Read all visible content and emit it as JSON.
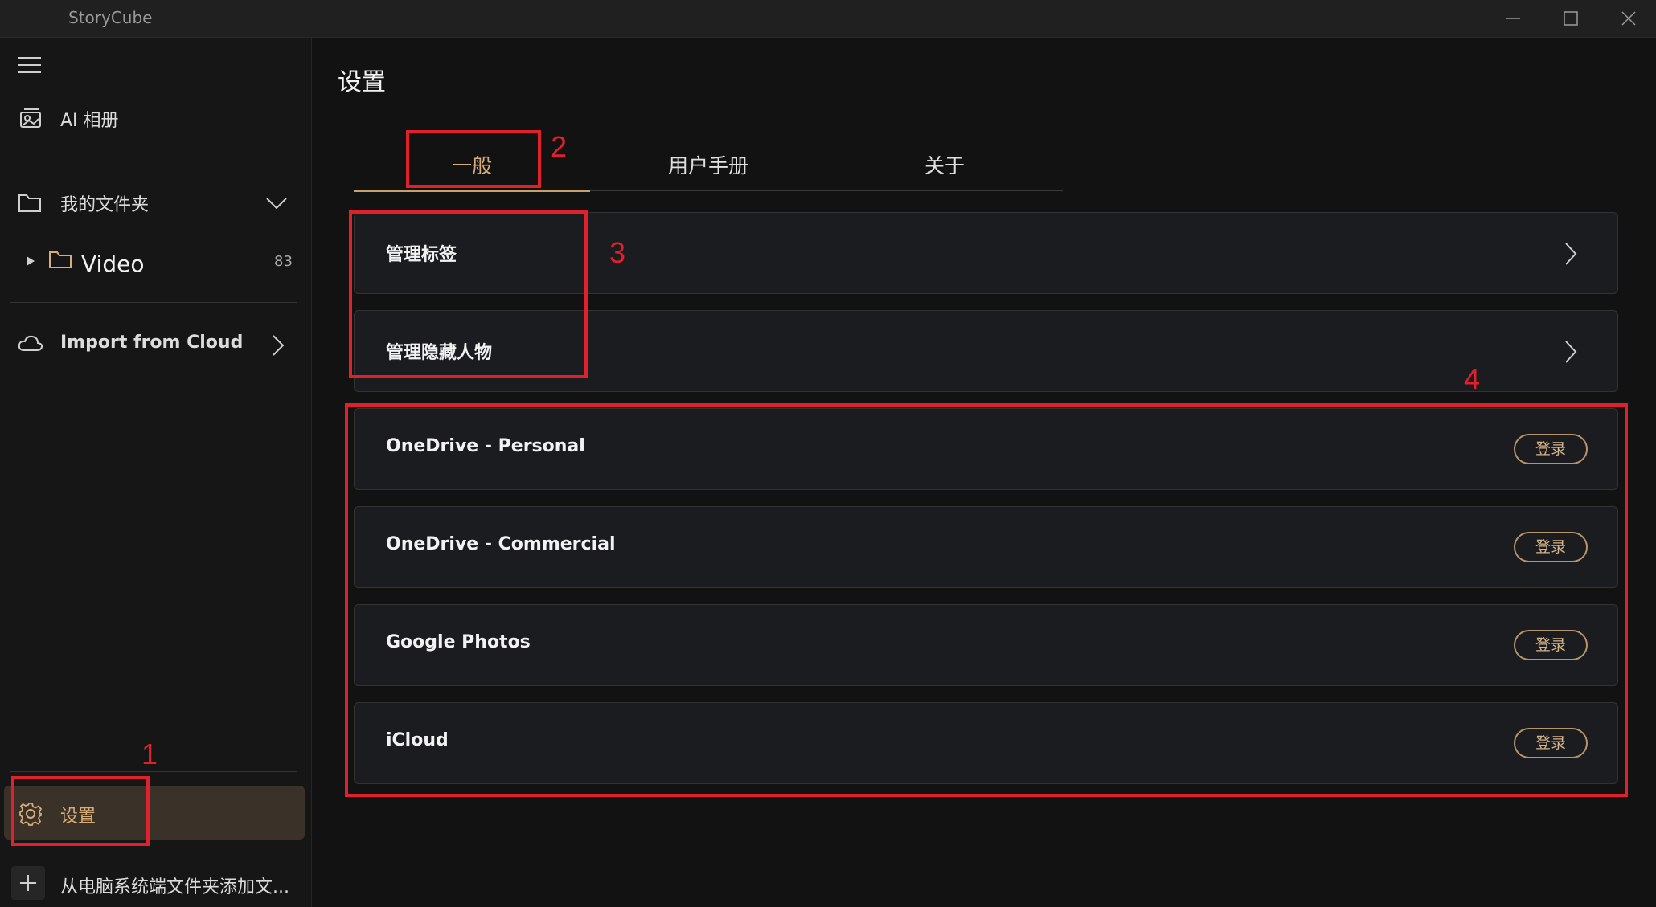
{
  "window": {
    "title": "StoryCube"
  },
  "sidebar": {
    "ai_album": "AI 相册",
    "my_folders": "我的文件夹",
    "folder_name": "Video",
    "folder_count": "83",
    "import_from_cloud": "Import from Cloud",
    "settings": "设置",
    "add_folder": "从电脑系统端文件夹添加文..."
  },
  "main": {
    "page_title": "设置",
    "tabs": [
      {
        "label": "一般",
        "active": true
      },
      {
        "label": "用户手册",
        "active": false
      },
      {
        "label": "关于",
        "active": false
      }
    ],
    "settings_rows": [
      {
        "label": "管理标签"
      },
      {
        "label": "管理隐藏人物"
      }
    ],
    "cloud_accounts": [
      {
        "label": "OneDrive - Personal",
        "button": "登录"
      },
      {
        "label": "OneDrive - Commercial",
        "button": "登录"
      },
      {
        "label": "Google Photos",
        "button": "登录"
      },
      {
        "label": "iCloud",
        "button": "登录"
      }
    ]
  },
  "annotations": [
    "1",
    "2",
    "3",
    "4"
  ],
  "colors": {
    "accent": "#d7ad7a",
    "annotation": "#e0202a",
    "background": "#121212",
    "card": "#1b1c1f"
  }
}
